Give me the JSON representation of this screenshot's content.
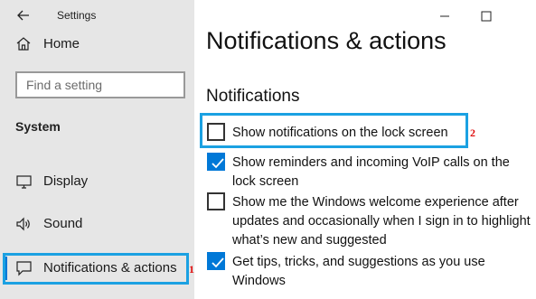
{
  "window": {
    "title": "Settings"
  },
  "sidebar": {
    "home_label": "Home",
    "search_placeholder": "Find a setting",
    "section_header": "System",
    "items": [
      {
        "label": "Display",
        "icon": "display-icon"
      },
      {
        "label": "Sound",
        "icon": "speaker-icon"
      },
      {
        "label": "Notifications & actions",
        "icon": "notification-icon",
        "selected": true
      }
    ]
  },
  "main": {
    "page_title": "Notifications & actions",
    "section_title": "Notifications",
    "options": [
      {
        "label": "Show notifications on the lock screen",
        "checked": false
      },
      {
        "label": "Show reminders and incoming VoIP calls on the lock screen",
        "checked": true
      },
      {
        "label": "Show me the Windows welcome experience after updates and occasionally when I sign in to highlight what’s new and suggested",
        "checked": false
      },
      {
        "label": "Get tips, tricks, and suggestions as you use Windows",
        "checked": true
      }
    ]
  },
  "annotations": {
    "marker_1": "1",
    "marker_2": "2"
  },
  "colors": {
    "accent": "#0078d7",
    "highlight": "#1ba1e2",
    "annotation": "#e01010",
    "sidebar_bg": "#e6e6e6"
  }
}
